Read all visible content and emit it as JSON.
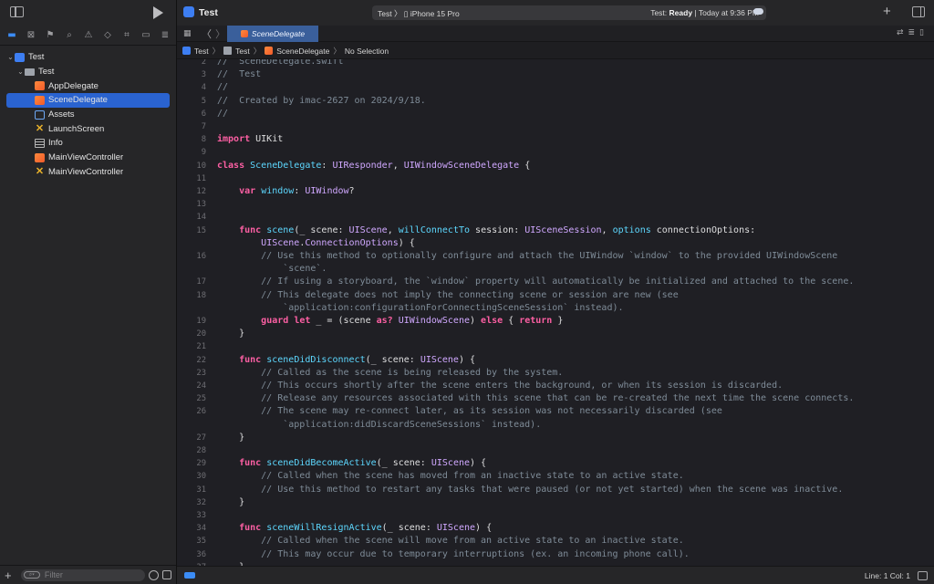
{
  "toolbar": {
    "project_name": "Test",
    "scheme_label": "Test 〉 ▯ iPhone 15 Pro",
    "status_prefix": "Test:",
    "status_state": "Ready",
    "status_time": "| Today at 9:36 PM",
    "add_label": "+"
  },
  "navigator": {
    "items": [
      {
        "label": "Test",
        "icon": "app-icon",
        "indent": 0,
        "chevron": "⌄",
        "selected": false
      },
      {
        "label": "Test",
        "icon": "folder-icon",
        "indent": 1,
        "chevron": "⌄",
        "selected": false
      },
      {
        "label": "AppDelegate",
        "icon": "swift-file-icon",
        "indent": 2,
        "chevron": "",
        "selected": false
      },
      {
        "label": "SceneDelegate",
        "icon": "swift-file-icon",
        "indent": 2,
        "chevron": "",
        "selected": true
      },
      {
        "label": "Assets",
        "icon": "assets-icon",
        "indent": 2,
        "chevron": "",
        "selected": false
      },
      {
        "label": "LaunchScreen",
        "icon": "storyboard-icon",
        "indent": 2,
        "chevron": "",
        "selected": false
      },
      {
        "label": "Info",
        "icon": "plist-icon",
        "indent": 2,
        "chevron": "",
        "selected": false
      },
      {
        "label": "MainViewController",
        "icon": "swift-file-icon",
        "indent": 2,
        "chevron": "",
        "selected": false
      },
      {
        "label": "MainViewController",
        "icon": "storyboard-icon",
        "indent": 2,
        "chevron": "",
        "selected": false
      }
    ],
    "filter_placeholder": "Filter"
  },
  "tab": {
    "label": "SceneDelegate"
  },
  "jumpbar": {
    "crumbs": [
      "Test",
      "Test",
      "SceneDelegate",
      "No Selection"
    ]
  },
  "editor": {
    "lines": [
      {
        "n": "2",
        "segs": [
          [
            "c-comment",
            "//  SceneDelegate.swift"
          ]
        ]
      },
      {
        "n": "3",
        "segs": [
          [
            "c-comment",
            "//  Test"
          ]
        ]
      },
      {
        "n": "4",
        "segs": [
          [
            "c-comment",
            "//"
          ]
        ]
      },
      {
        "n": "5",
        "segs": [
          [
            "c-comment",
            "//  Created by imac-2627 on 2024/9/18."
          ]
        ]
      },
      {
        "n": "6",
        "segs": [
          [
            "c-comment",
            "//"
          ]
        ]
      },
      {
        "n": "7",
        "segs": []
      },
      {
        "n": "8",
        "segs": [
          [
            "c-kw",
            "import"
          ],
          [
            "c-plain",
            " UIKit"
          ]
        ]
      },
      {
        "n": "9",
        "segs": []
      },
      {
        "n": "10",
        "segs": [
          [
            "c-kw",
            "class"
          ],
          [
            "c-plain",
            " "
          ],
          [
            "c-decl",
            "SceneDelegate"
          ],
          [
            "c-plain",
            ": "
          ],
          [
            "c-type",
            "UIResponder"
          ],
          [
            "c-plain",
            ", "
          ],
          [
            "c-type",
            "UIWindowSceneDelegate"
          ],
          [
            "c-plain",
            " {"
          ]
        ]
      },
      {
        "n": "11",
        "segs": []
      },
      {
        "n": "12",
        "segs": [
          [
            "c-plain",
            "    "
          ],
          [
            "c-kw",
            "var"
          ],
          [
            "c-plain",
            " "
          ],
          [
            "c-decl",
            "window"
          ],
          [
            "c-plain",
            ": "
          ],
          [
            "c-type",
            "UIWindow"
          ],
          [
            "c-plain",
            "?"
          ]
        ]
      },
      {
        "n": "13",
        "segs": []
      },
      {
        "n": "14",
        "segs": []
      },
      {
        "n": "15",
        "segs": [
          [
            "c-plain",
            "    "
          ],
          [
            "c-kw",
            "func"
          ],
          [
            "c-plain",
            " "
          ],
          [
            "c-decl",
            "scene"
          ],
          [
            "c-plain",
            "(_ scene: "
          ],
          [
            "c-type",
            "UIScene"
          ],
          [
            "c-plain",
            ", "
          ],
          [
            "c-decl",
            "willConnectTo"
          ],
          [
            "c-plain",
            " session: "
          ],
          [
            "c-type",
            "UISceneSession"
          ],
          [
            "c-plain",
            ", "
          ],
          [
            "c-decl",
            "options"
          ],
          [
            "c-plain",
            " connectionOptions:"
          ]
        ]
      },
      {
        "n": "",
        "segs": [
          [
            "c-plain",
            "        "
          ],
          [
            "c-type",
            "UIScene"
          ],
          [
            "c-plain",
            "."
          ],
          [
            "c-type",
            "ConnectionOptions"
          ],
          [
            "c-plain",
            ") {"
          ]
        ]
      },
      {
        "n": "16",
        "segs": [
          [
            "c-comment",
            "        // Use this method to optionally configure and attach the UIWindow `window` to the provided UIWindowScene"
          ]
        ]
      },
      {
        "n": "",
        "segs": [
          [
            "c-comment",
            "            `scene`."
          ]
        ]
      },
      {
        "n": "17",
        "segs": [
          [
            "c-comment",
            "        // If using a storyboard, the `window` property will automatically be initialized and attached to the scene."
          ]
        ]
      },
      {
        "n": "18",
        "segs": [
          [
            "c-comment",
            "        // This delegate does not imply the connecting scene or session are new (see"
          ]
        ]
      },
      {
        "n": "",
        "segs": [
          [
            "c-comment",
            "            `application:configurationForConnectingSceneSession` instead)."
          ]
        ]
      },
      {
        "n": "19",
        "segs": [
          [
            "c-plain",
            "        "
          ],
          [
            "c-kw",
            "guard"
          ],
          [
            "c-plain",
            " "
          ],
          [
            "c-kw",
            "let"
          ],
          [
            "c-plain",
            " _ = (scene "
          ],
          [
            "c-kw",
            "as?"
          ],
          [
            "c-plain",
            " "
          ],
          [
            "c-type",
            "UIWindowScene"
          ],
          [
            "c-plain",
            ") "
          ],
          [
            "c-kw",
            "else"
          ],
          [
            "c-plain",
            " { "
          ],
          [
            "c-kw",
            "return"
          ],
          [
            "c-plain",
            " }"
          ]
        ]
      },
      {
        "n": "20",
        "segs": [
          [
            "c-plain",
            "    }"
          ]
        ]
      },
      {
        "n": "21",
        "segs": []
      },
      {
        "n": "22",
        "segs": [
          [
            "c-plain",
            "    "
          ],
          [
            "c-kw",
            "func"
          ],
          [
            "c-plain",
            " "
          ],
          [
            "c-decl",
            "sceneDidDisconnect"
          ],
          [
            "c-plain",
            "(_ scene: "
          ],
          [
            "c-type",
            "UIScene"
          ],
          [
            "c-plain",
            ") {"
          ]
        ]
      },
      {
        "n": "23",
        "segs": [
          [
            "c-comment",
            "        // Called as the scene is being released by the system."
          ]
        ]
      },
      {
        "n": "24",
        "segs": [
          [
            "c-comment",
            "        // This occurs shortly after the scene enters the background, or when its session is discarded."
          ]
        ]
      },
      {
        "n": "25",
        "segs": [
          [
            "c-comment",
            "        // Release any resources associated with this scene that can be re-created the next time the scene connects."
          ]
        ]
      },
      {
        "n": "26",
        "segs": [
          [
            "c-comment",
            "        // The scene may re-connect later, as its session was not necessarily discarded (see"
          ]
        ]
      },
      {
        "n": "",
        "segs": [
          [
            "c-comment",
            "            `application:didDiscardSceneSessions` instead)."
          ]
        ]
      },
      {
        "n": "27",
        "segs": [
          [
            "c-plain",
            "    }"
          ]
        ]
      },
      {
        "n": "28",
        "segs": []
      },
      {
        "n": "29",
        "segs": [
          [
            "c-plain",
            "    "
          ],
          [
            "c-kw",
            "func"
          ],
          [
            "c-plain",
            " "
          ],
          [
            "c-decl",
            "sceneDidBecomeActive"
          ],
          [
            "c-plain",
            "(_ scene: "
          ],
          [
            "c-type",
            "UIScene"
          ],
          [
            "c-plain",
            ") {"
          ]
        ]
      },
      {
        "n": "30",
        "segs": [
          [
            "c-comment",
            "        // Called when the scene has moved from an inactive state to an active state."
          ]
        ]
      },
      {
        "n": "31",
        "segs": [
          [
            "c-comment",
            "        // Use this method to restart any tasks that were paused (or not yet started) when the scene was inactive."
          ]
        ]
      },
      {
        "n": "32",
        "segs": [
          [
            "c-plain",
            "    }"
          ]
        ]
      },
      {
        "n": "33",
        "segs": []
      },
      {
        "n": "34",
        "segs": [
          [
            "c-plain",
            "    "
          ],
          [
            "c-kw",
            "func"
          ],
          [
            "c-plain",
            " "
          ],
          [
            "c-decl",
            "sceneWillResignActive"
          ],
          [
            "c-plain",
            "(_ scene: "
          ],
          [
            "c-type",
            "UIScene"
          ],
          [
            "c-plain",
            ") {"
          ]
        ]
      },
      {
        "n": "35",
        "segs": [
          [
            "c-comment",
            "        // Called when the scene will move from an active state to an inactive state."
          ]
        ]
      },
      {
        "n": "36",
        "segs": [
          [
            "c-comment",
            "        // This may occur due to temporary interruptions (ex. an incoming phone call)."
          ]
        ]
      },
      {
        "n": "37",
        "segs": [
          [
            "c-plain",
            "    }"
          ]
        ]
      }
    ]
  },
  "statusbar": {
    "position": "Line: 1  Col: 1"
  },
  "colors": {
    "accent": "#2a63d0",
    "keyword": "#fc5fa3",
    "type": "#d0a8ff",
    "declaration": "#5dd8ff",
    "comment": "#7f8c98"
  }
}
